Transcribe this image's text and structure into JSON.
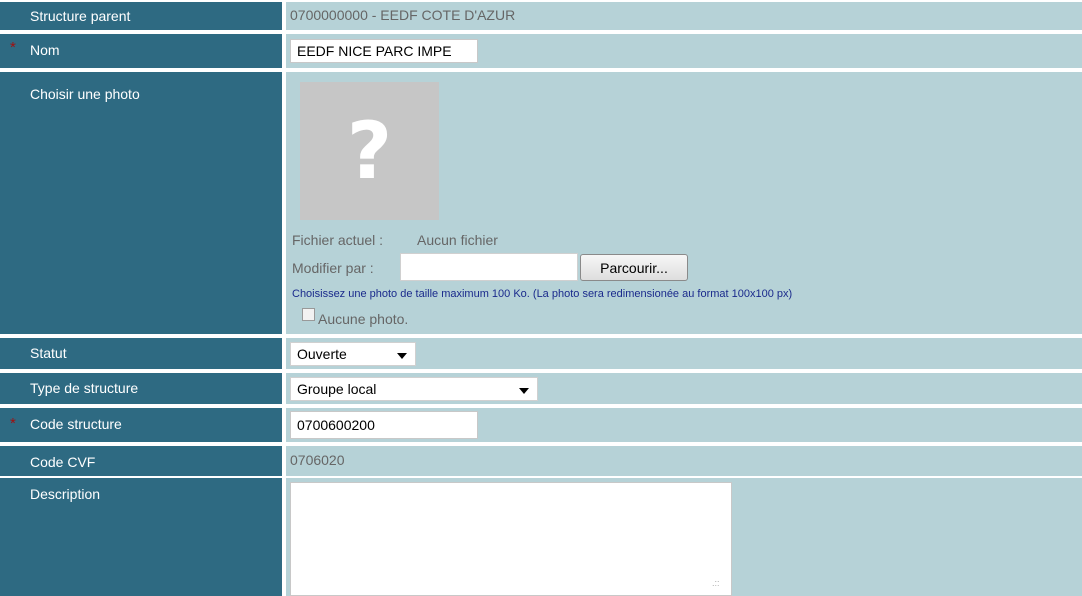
{
  "fields": {
    "structure_parent": {
      "label": "Structure parent",
      "value": "0700000000 - EEDF COTE D'AZUR"
    },
    "nom": {
      "label": "Nom",
      "value": "EEDF NICE PARC IMPE",
      "required_mark": "*"
    },
    "photo": {
      "label": "Choisir une photo",
      "placeholder_glyph": "?",
      "current_label": "Fichier actuel :",
      "current_value": "Aucun fichier",
      "modify_label": "Modifier par :",
      "browse_button": "Parcourir...",
      "hint": "Choisissez une photo de taille maximum 100 Ko. (La photo sera redimensionée au format 100x100 px)",
      "no_photo_label": "Aucune photo."
    },
    "statut": {
      "label": "Statut",
      "value": "Ouverte"
    },
    "type_structure": {
      "label": "Type de structure",
      "value": "Groupe local"
    },
    "code_structure": {
      "label": "Code structure",
      "value": "0700600200",
      "required_mark": "*"
    },
    "code_cvf": {
      "label": "Code CVF",
      "value": "0706020"
    },
    "description": {
      "label": "Description",
      "value": ""
    }
  },
  "colors": {
    "label_bg": "#2e6a82",
    "value_bg": "#b6d2d7",
    "required": "#a01010",
    "hint": "#1a2a8c"
  },
  "icons": {
    "required": "star-icon",
    "dropdown": "chevron-down-icon",
    "photo": "question-mark-icon"
  }
}
